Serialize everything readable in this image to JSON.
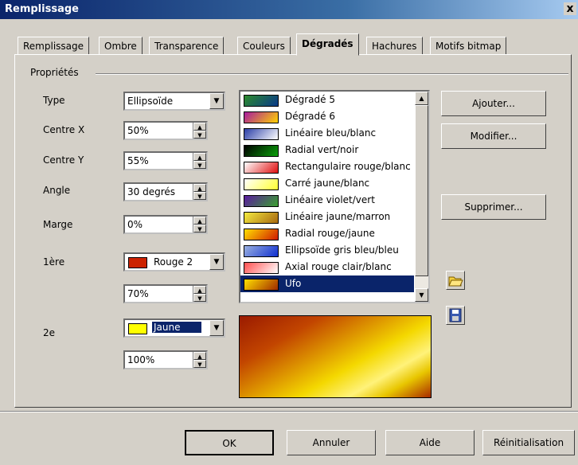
{
  "window": {
    "title": "Remplissage",
    "close": "x"
  },
  "tabs": [
    "Remplissage",
    "Ombre",
    "Transparence",
    "Couleurs",
    "Dégradés",
    "Hachures",
    "Motifs bitmap"
  ],
  "active_tab": "Dégradés",
  "group": {
    "label": "Propriétés"
  },
  "fields": {
    "type": {
      "label": "Type",
      "value": "Ellipsoïde"
    },
    "centre_x": {
      "label": "Centre X",
      "value": "50%"
    },
    "centre_y": {
      "label": "Centre Y",
      "value": "55%"
    },
    "angle": {
      "label": "Angle",
      "value": "30 degrés"
    },
    "marge": {
      "label": "Marge",
      "value": "0%"
    },
    "premiere": {
      "label": "1ère",
      "color_name": "Rouge 2",
      "color": "#cc2200",
      "intensity": "70%"
    },
    "deuxieme": {
      "label": "2e",
      "color_name": "Jaune",
      "color": "#ffff00",
      "intensity": "100%"
    }
  },
  "gradients": [
    {
      "name": "Dégradé 5",
      "c1": "#2c8a2c",
      "c2": "#0a3a8a"
    },
    {
      "name": "Dégradé 6",
      "c1": "#a81b9e",
      "c2": "#ffd200"
    },
    {
      "name": "Linéaire bleu/blanc",
      "c1": "#2a3ea8",
      "c2": "#ffffff"
    },
    {
      "name": "Radial vert/noir",
      "c1": "#000000",
      "c2": "#0aa00a"
    },
    {
      "name": "Rectangulaire rouge/blanc",
      "c1": "#ffffff",
      "c2": "#e01010"
    },
    {
      "name": "Carré jaune/blanc",
      "c1": "#ffffff",
      "c2": "#ffff30"
    },
    {
      "name": "Linéaire violet/vert",
      "c1": "#5a1aa0",
      "c2": "#3aa030"
    },
    {
      "name": "Linéaire jaune/marron",
      "c1": "#f4ea40",
      "c2": "#a86a10"
    },
    {
      "name": "Radial rouge/jaune",
      "c1": "#ffe000",
      "c2": "#d01a00"
    },
    {
      "name": "Ellipsoïde gris bleu/bleu",
      "c1": "#9ab0e0",
      "c2": "#1030d0"
    },
    {
      "name": "Axial rouge clair/blanc",
      "c1": "#ff5050",
      "c2": "#ffffff"
    },
    {
      "name": "Ufo",
      "c1": "#ffe000",
      "c2": "#a02a00"
    }
  ],
  "selected_gradient": "Ufo",
  "side_buttons": {
    "add": "Ajouter...",
    "modify": "Modifier...",
    "delete": "Supprimer..."
  },
  "icons": {
    "open": "folder-open-icon",
    "save": "floppy-disk-icon"
  },
  "footer": {
    "ok": "OK",
    "cancel": "Annuler",
    "help": "Aide",
    "reset": "Réinitialisation"
  }
}
